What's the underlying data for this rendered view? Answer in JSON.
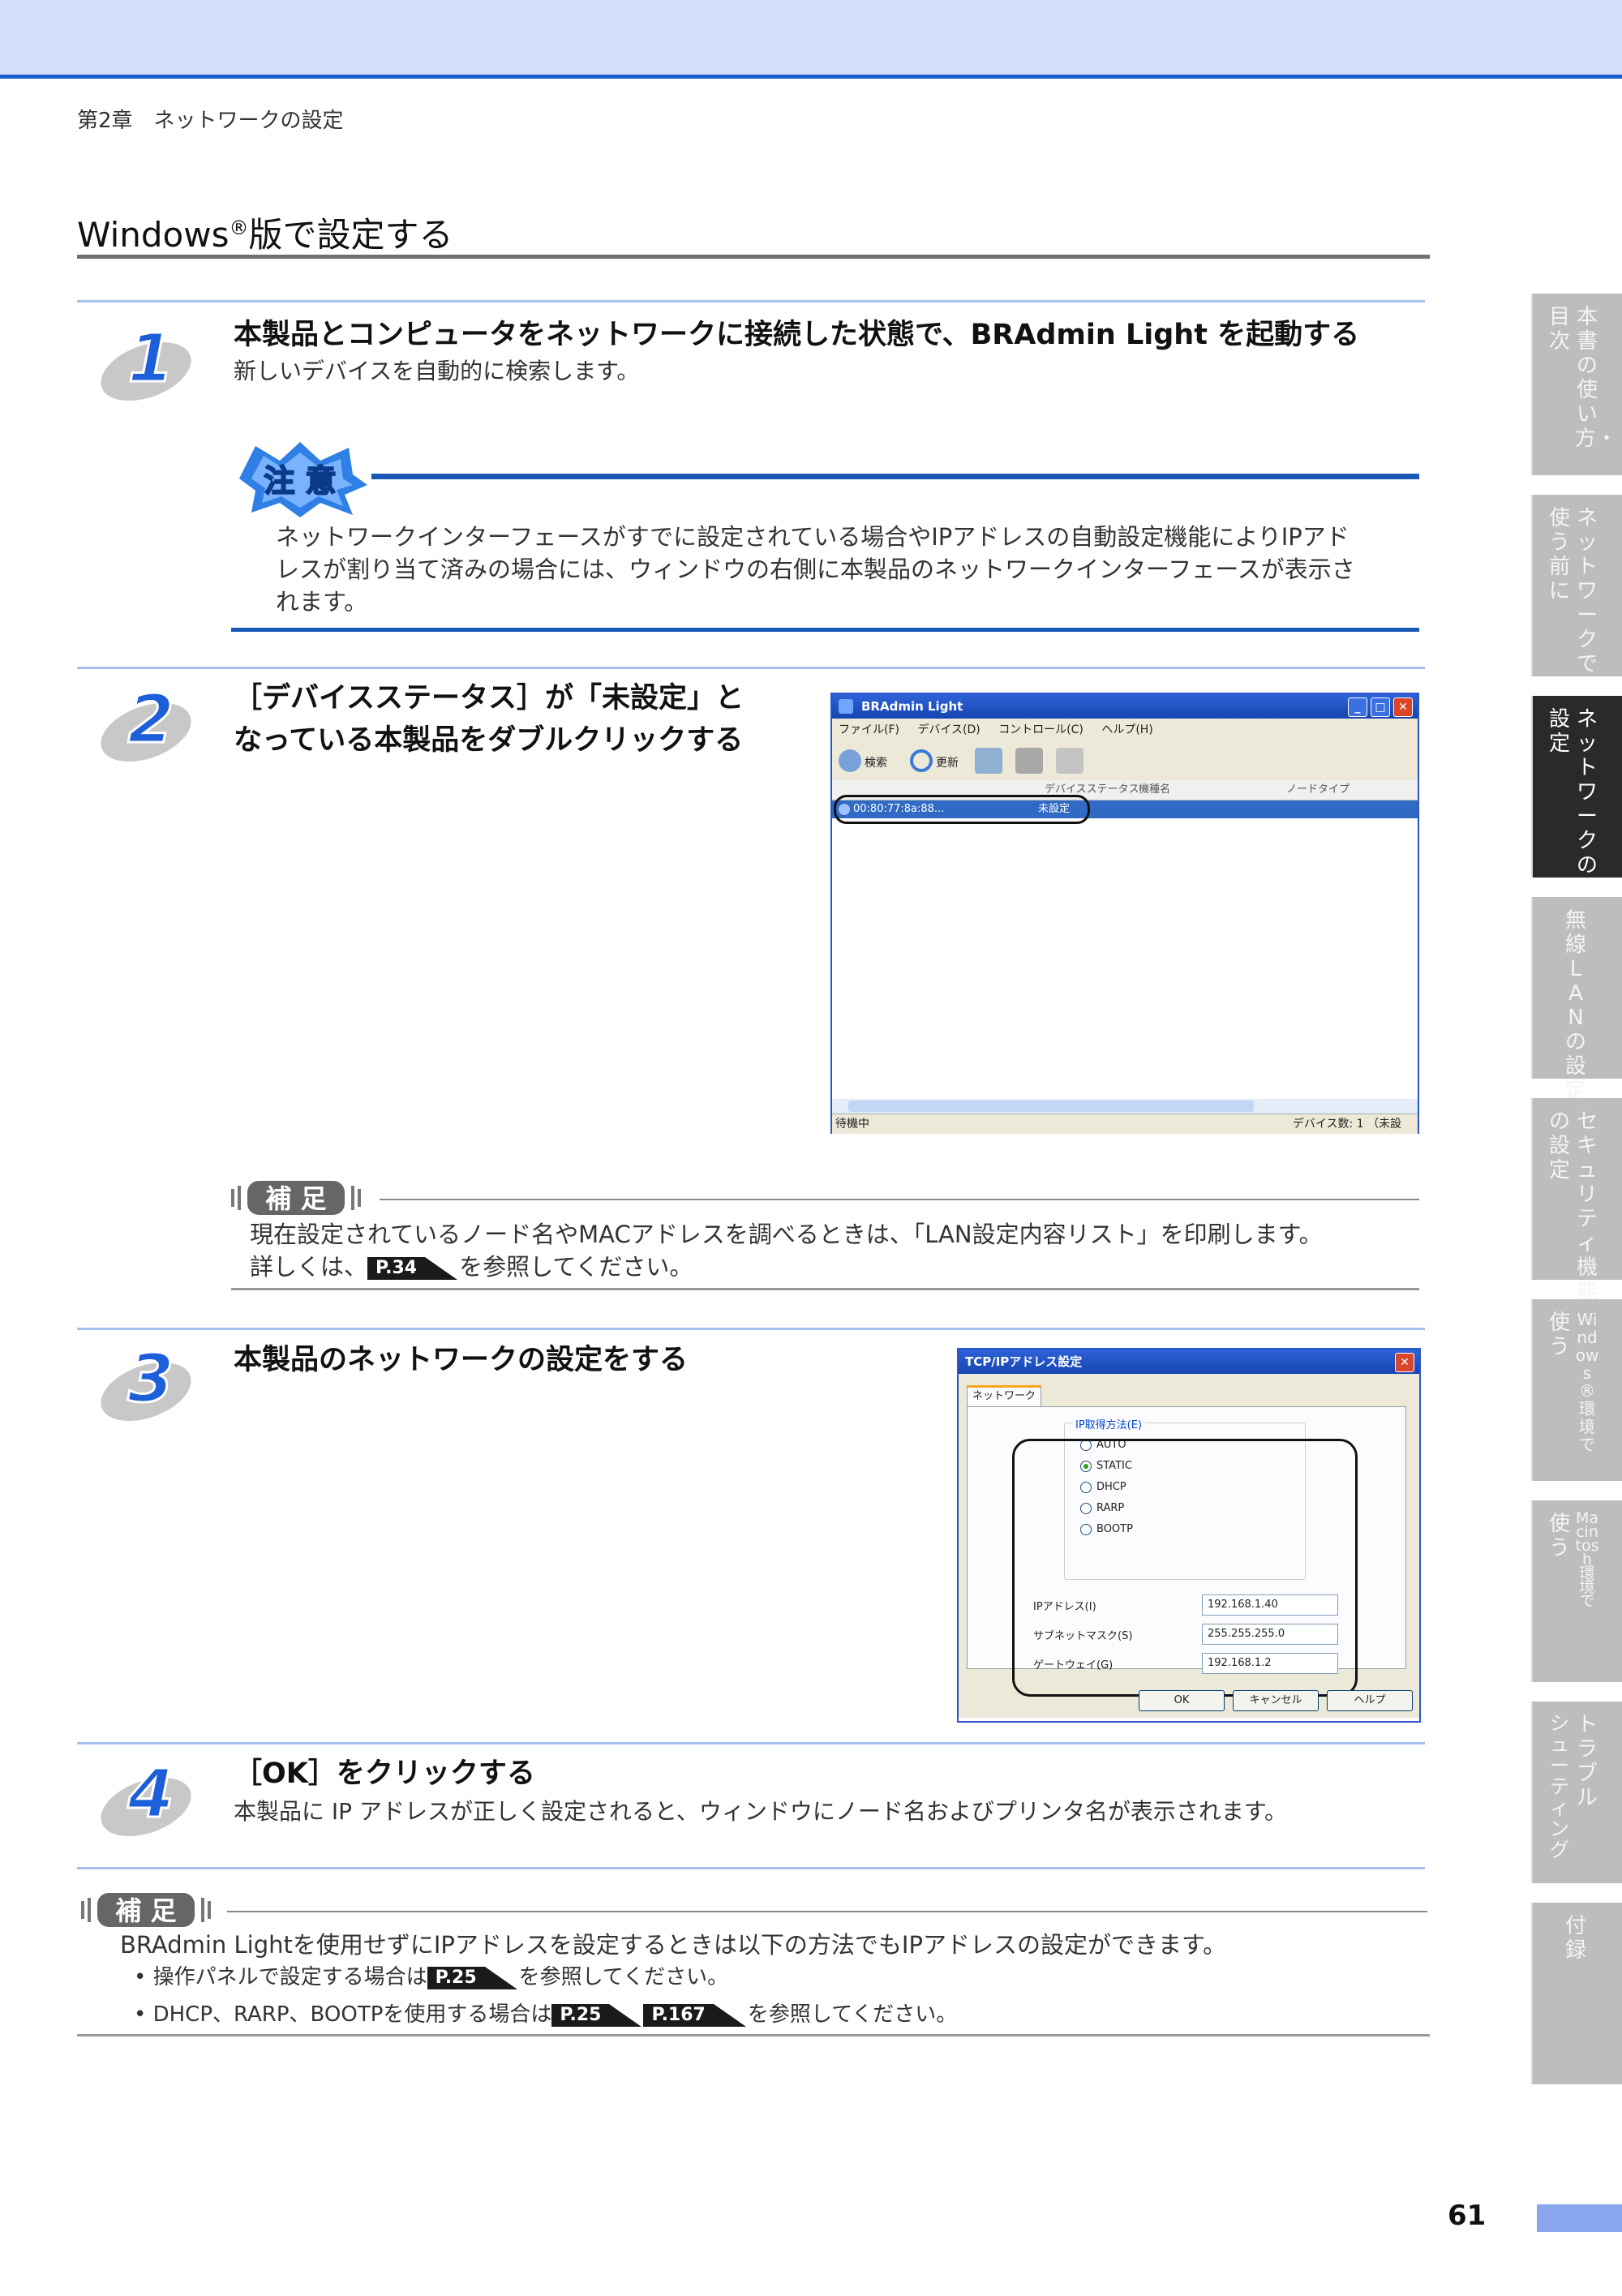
{
  "header": {
    "chapter": "第2章　ネットワークの設定",
    "section_title_main": "Windows",
    "section_title_sup": "®",
    "section_title_rest": "版で設定する"
  },
  "steps": [
    {
      "number": "1",
      "title": "本製品とコンピュータをネットワークに接続した状態で、BRAdmin Light を起動する",
      "desc": "新しいデバイスを自動的に検索します。"
    },
    {
      "number": "2",
      "title_line1": "［デバイスステータス］が「未設定」と",
      "title_line2": "なっている本製品をダブルクリックする"
    },
    {
      "number": "3",
      "title": "本製品のネットワークの設定をする"
    },
    {
      "number": "4",
      "title": "［OK］をクリックする",
      "desc": "本製品に IP アドレスが正しく設定されると、ウィンドウにノード名およびプリンタ名が表示されます。"
    }
  ],
  "caution": {
    "badge": "注 意",
    "line1": "ネットワークインターフェースがすでに設定されている場合やIPアドレスの自動設定機能によりIPアド",
    "line2": "レスが割り当て済みの場合には、ウィンドウの右側に本製品のネットワークインターフェースが表示さ",
    "line3": "れます。"
  },
  "hosoku1": {
    "badge": "補 足",
    "line1": "現在設定されているノード名やMACアドレスを調べるときは、「LAN設定内容リスト」を印刷します。",
    "line2_pre": "詳しくは、",
    "ref": "P.34",
    "line2_post": "を参照してください。"
  },
  "hosoku2": {
    "badge": "補 足",
    "line1": "BRAdmin Lightを使用せずにIPアドレスを設定するときは以下の方法でもIPアドレスの設定ができます。",
    "bullet1_pre": "• 操作パネルで設定する場合は",
    "bullet1_ref": "P.25",
    "bullet1_post": "を参照してください。",
    "bullet2_pre": "• DHCP、RARP、BOOTPを使用する場合は",
    "bullet2_ref1": "P.25",
    "bullet2_ref2": "P.167",
    "bullet2_post": "を参照してください。"
  },
  "bradmin": {
    "title": "BRAdmin Light",
    "menu": [
      "ファイル(F)",
      "デバイス(D)",
      "コントロール(C)",
      "ヘルプ(H)"
    ],
    "toolbar_search": "検索",
    "toolbar_update": "更新",
    "col_status": "デバイスステータス",
    "col_model": "機種名",
    "col_nodetype": "ノードタイプ",
    "row_node": "00:80:77:8a:88...",
    "row_status": "未設定",
    "status_left": "待機中",
    "status_right": "デバイス数: 1 （未設"
  },
  "tcpip": {
    "title": "TCP/IPアドレス設定",
    "tab": "ネットワーク",
    "group": "IP取得方法(E)",
    "options": [
      "AUTO",
      "STATIC",
      "DHCP",
      "RARP",
      "BOOTP"
    ],
    "selected": "STATIC",
    "ip_label": "IPアドレス(I)",
    "ip_value": "192.168.1.40",
    "mask_label": "サブネットマスク(S)",
    "mask_value": "255.255.255.0",
    "gw_label": "ゲートウェイ(G)",
    "gw_value": "192.168.1.2",
    "ok": "OK",
    "cancel": "キャンセル",
    "help": "ヘルプ"
  },
  "side_tabs": [
    {
      "col1": "本書の使い方・",
      "col2": "目次",
      "active": false
    },
    {
      "col1": "ネットワークで",
      "col2": "使う前に",
      "active": false
    },
    {
      "col1": "ネットワークの",
      "col2": "設定",
      "active": true
    },
    {
      "col1": "無線LANの設定",
      "col2": "",
      "active": false
    },
    {
      "col1": "セキュリティ機能",
      "col2": "の設定",
      "active": false
    },
    {
      "col1": "Windows®環境で",
      "col2": "使う",
      "active": false
    },
    {
      "col1": "Macintosh環境で",
      "col2": "使う",
      "active": false
    },
    {
      "col1": "トラブル",
      "col2": "シューティング",
      "active": false
    },
    {
      "col1": "付録",
      "col2": "",
      "active": false
    }
  ],
  "page_number": "61"
}
